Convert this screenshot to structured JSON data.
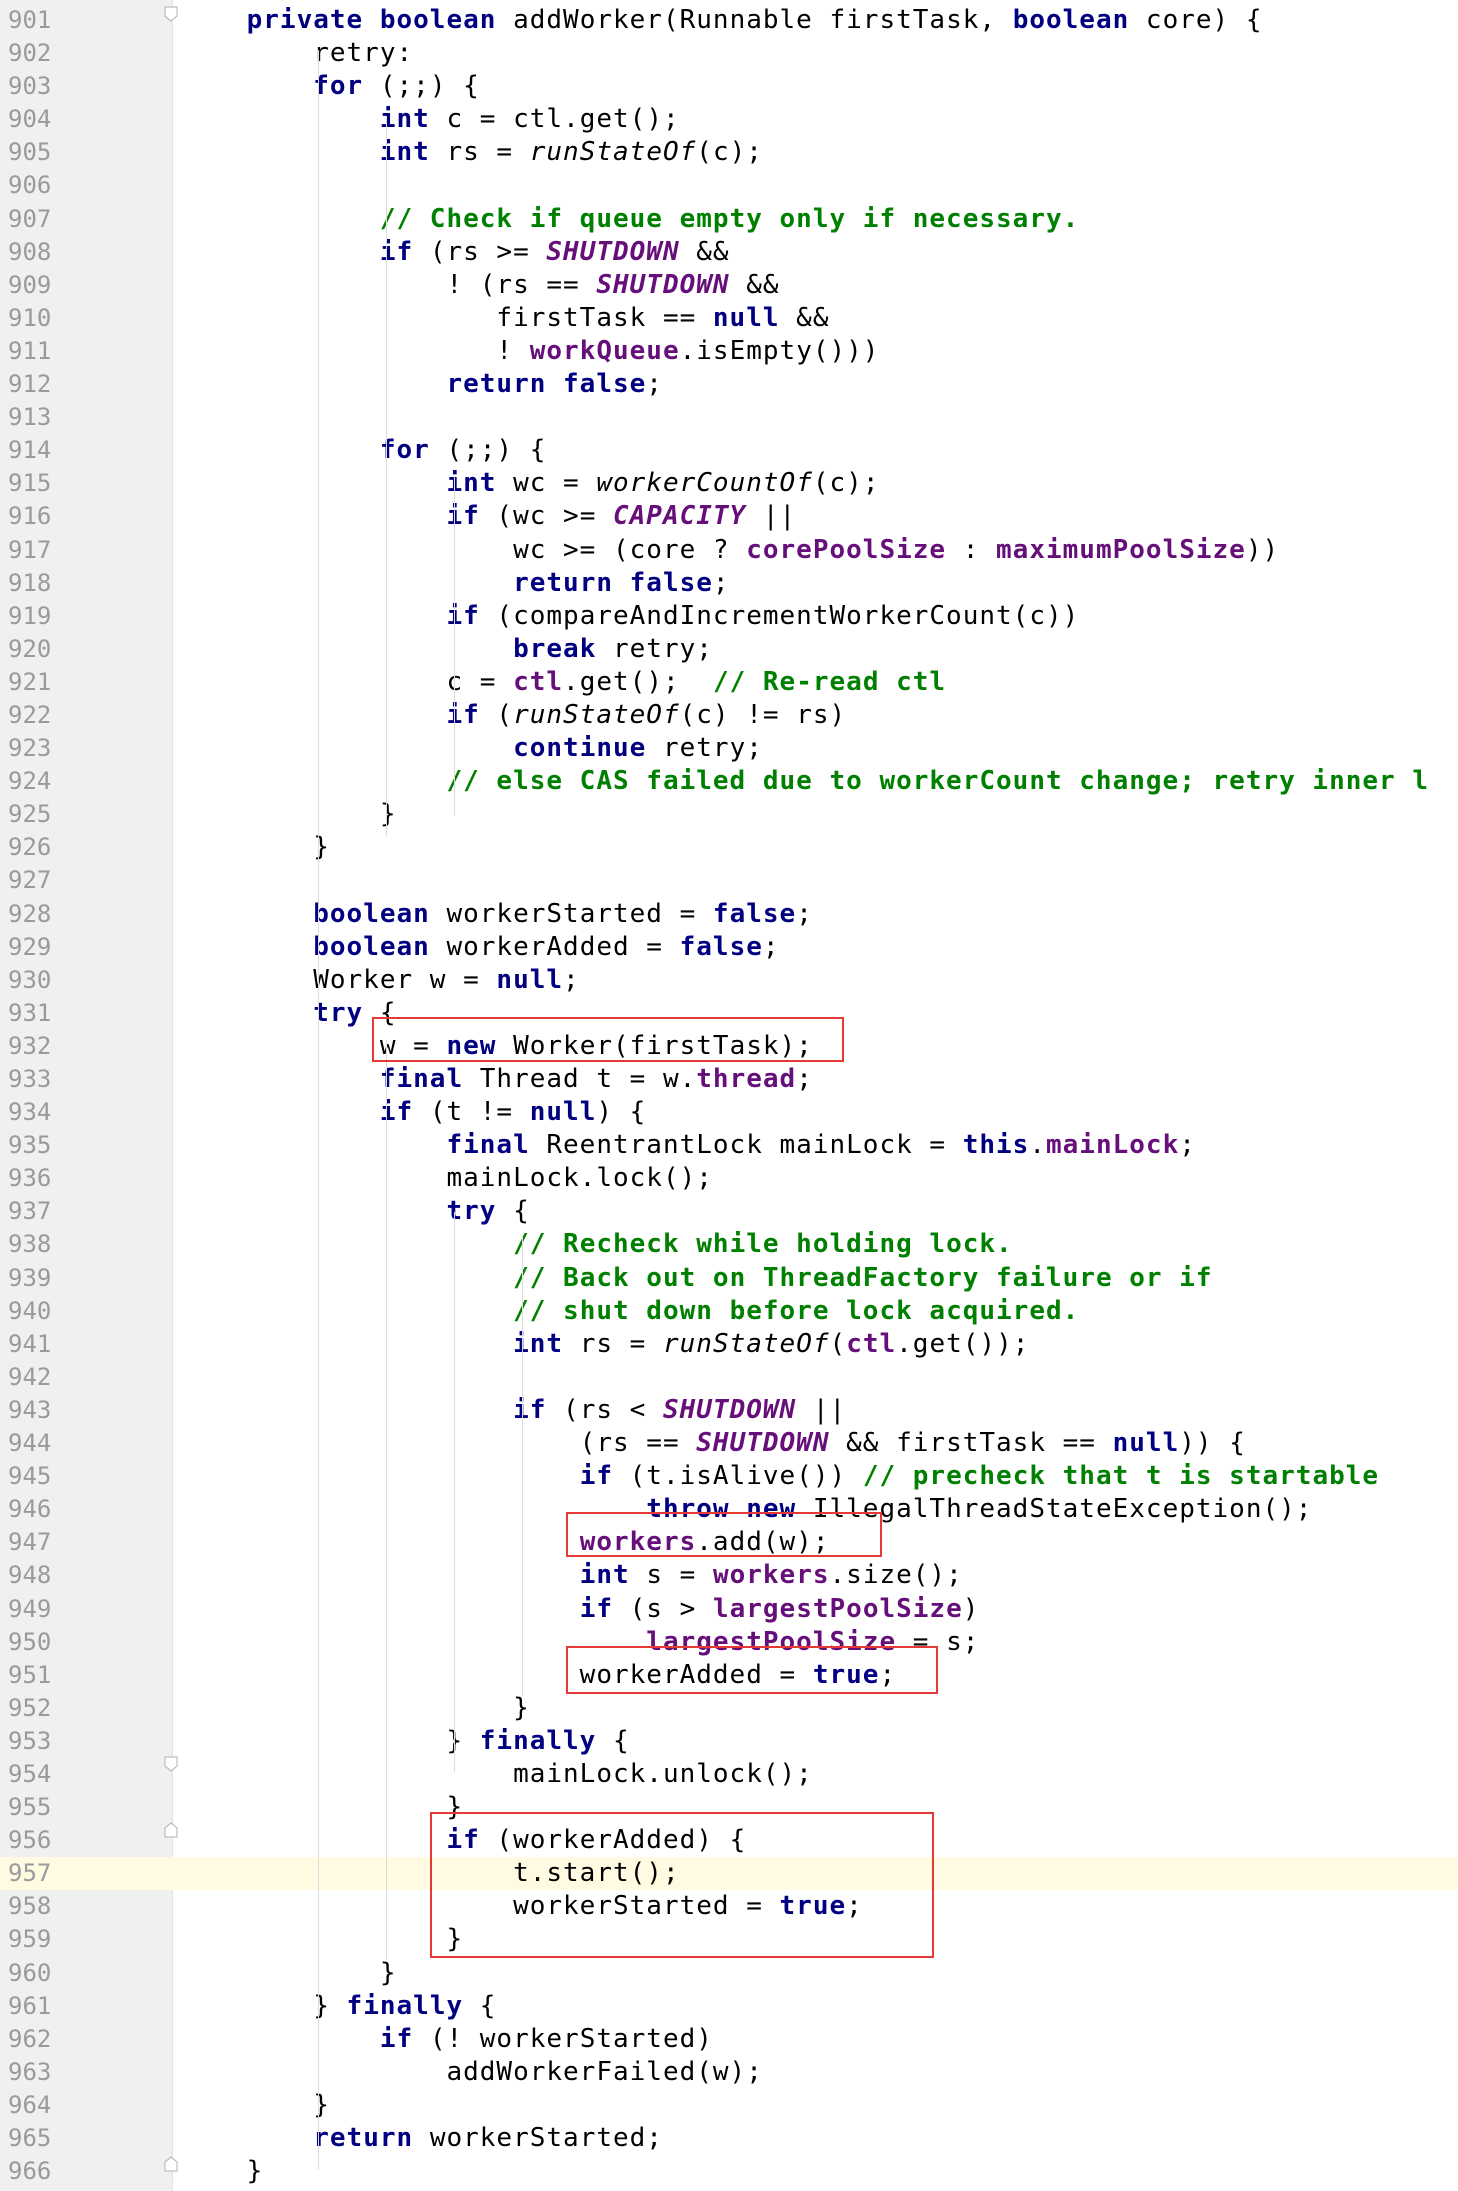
{
  "editor": {
    "colors": {
      "keyword": "#000080",
      "field": "#660e7a",
      "comment": "#008000",
      "highlight_box": "#e53935",
      "caret_line": "#fffbe3",
      "gutter": "#f0f0f0"
    },
    "caret_line": 957,
    "lines": [
      {
        "n": "901",
        "segs": [
          [
            "    ",
            ""
          ],
          [
            "private boolean ",
            "kw"
          ],
          [
            "addWorker(Runnable firstTask, ",
            ""
          ],
          [
            "boolean ",
            "kw"
          ],
          [
            "core) {",
            ""
          ]
        ]
      },
      {
        "n": "902",
        "segs": [
          [
            "        retry:",
            ""
          ]
        ]
      },
      {
        "n": "903",
        "segs": [
          [
            "        ",
            ""
          ],
          [
            "for ",
            "kw"
          ],
          [
            "(;;) {",
            ""
          ]
        ]
      },
      {
        "n": "904",
        "segs": [
          [
            "            ",
            ""
          ],
          [
            "int ",
            "kw"
          ],
          [
            "c = ",
            ""
          ],
          [
            "ctl",
            ""
          ],
          [
            ".get();",
            ""
          ]
        ]
      },
      {
        "n": "905",
        "segs": [
          [
            "            ",
            ""
          ],
          [
            "int ",
            "kw"
          ],
          [
            "rs = ",
            ""
          ],
          [
            "runStateOf",
            "it"
          ],
          [
            "(c);",
            ""
          ]
        ]
      },
      {
        "n": "906",
        "segs": []
      },
      {
        "n": "907",
        "segs": [
          [
            "            ",
            ""
          ],
          [
            "// Check if queue empty only if necessary.",
            "cm"
          ]
        ]
      },
      {
        "n": "908",
        "segs": [
          [
            "            ",
            ""
          ],
          [
            "if ",
            "kw"
          ],
          [
            "(rs >= ",
            ""
          ],
          [
            "SHUTDOWN",
            "cst"
          ],
          [
            " &&",
            ""
          ]
        ]
      },
      {
        "n": "909",
        "segs": [
          [
            "                ! (rs == ",
            ""
          ],
          [
            "SHUTDOWN",
            "cst"
          ],
          [
            " &&",
            ""
          ]
        ]
      },
      {
        "n": "910",
        "segs": [
          [
            "                   firstTask == ",
            ""
          ],
          [
            "null",
            "kw"
          ],
          [
            " &&",
            ""
          ]
        ]
      },
      {
        "n": "911",
        "segs": [
          [
            "                   ! ",
            ""
          ],
          [
            "workQueue",
            "fld"
          ],
          [
            ".isEmpty()))",
            ""
          ]
        ]
      },
      {
        "n": "912",
        "segs": [
          [
            "                ",
            ""
          ],
          [
            "return false",
            "kw"
          ],
          [
            ";",
            ""
          ]
        ]
      },
      {
        "n": "913",
        "segs": []
      },
      {
        "n": "914",
        "segs": [
          [
            "            ",
            ""
          ],
          [
            "for ",
            "kw"
          ],
          [
            "(;;) {",
            ""
          ]
        ]
      },
      {
        "n": "915",
        "segs": [
          [
            "                ",
            ""
          ],
          [
            "int ",
            "kw"
          ],
          [
            "wc = ",
            ""
          ],
          [
            "workerCountOf",
            "it"
          ],
          [
            "(c);",
            ""
          ]
        ]
      },
      {
        "n": "916",
        "segs": [
          [
            "                ",
            ""
          ],
          [
            "if ",
            "kw"
          ],
          [
            "(wc >= ",
            ""
          ],
          [
            "CAPACITY",
            "cst"
          ],
          [
            " ||",
            ""
          ]
        ]
      },
      {
        "n": "917",
        "segs": [
          [
            "                    wc >= (core ? ",
            ""
          ],
          [
            "corePoolSize",
            "fld"
          ],
          [
            " : ",
            ""
          ],
          [
            "maximumPoolSize",
            "fld"
          ],
          [
            "))",
            ""
          ]
        ]
      },
      {
        "n": "918",
        "segs": [
          [
            "                    ",
            ""
          ],
          [
            "return false",
            "kw"
          ],
          [
            ";",
            ""
          ]
        ]
      },
      {
        "n": "919",
        "segs": [
          [
            "                ",
            ""
          ],
          [
            "if ",
            "kw"
          ],
          [
            "(compareAndIncrementWorkerCount(c))",
            ""
          ]
        ]
      },
      {
        "n": "920",
        "segs": [
          [
            "                    ",
            ""
          ],
          [
            "break ",
            "kw"
          ],
          [
            "retry;",
            ""
          ]
        ]
      },
      {
        "n": "921",
        "segs": [
          [
            "                c = ",
            ""
          ],
          [
            "ctl",
            "fld"
          ],
          [
            ".get();  ",
            ""
          ],
          [
            "// Re-read ctl",
            "cm"
          ]
        ]
      },
      {
        "n": "922",
        "segs": [
          [
            "                ",
            ""
          ],
          [
            "if ",
            "kw"
          ],
          [
            "(",
            ""
          ],
          [
            "runStateOf",
            "it"
          ],
          [
            "(c) != rs)",
            ""
          ]
        ]
      },
      {
        "n": "923",
        "segs": [
          [
            "                    ",
            ""
          ],
          [
            "continue ",
            "kw"
          ],
          [
            "retry;",
            ""
          ]
        ]
      },
      {
        "n": "924",
        "segs": [
          [
            "                ",
            ""
          ],
          [
            "// else CAS failed due to workerCount change; retry inner l",
            "cm"
          ]
        ]
      },
      {
        "n": "925",
        "segs": [
          [
            "            }",
            ""
          ]
        ]
      },
      {
        "n": "926",
        "segs": [
          [
            "        }",
            ""
          ]
        ]
      },
      {
        "n": "927",
        "segs": []
      },
      {
        "n": "928",
        "segs": [
          [
            "        ",
            ""
          ],
          [
            "boolean ",
            "kw"
          ],
          [
            "workerStarted = ",
            ""
          ],
          [
            "false",
            "kw"
          ],
          [
            ";",
            ""
          ]
        ]
      },
      {
        "n": "929",
        "segs": [
          [
            "        ",
            ""
          ],
          [
            "boolean ",
            "kw"
          ],
          [
            "workerAdded = ",
            ""
          ],
          [
            "false",
            "kw"
          ],
          [
            ";",
            ""
          ]
        ]
      },
      {
        "n": "930",
        "segs": [
          [
            "        Worker w = ",
            ""
          ],
          [
            "null",
            "kw"
          ],
          [
            ";",
            ""
          ]
        ]
      },
      {
        "n": "931",
        "segs": [
          [
            "        ",
            ""
          ],
          [
            "try ",
            "kw"
          ],
          [
            "{",
            ""
          ]
        ]
      },
      {
        "n": "932",
        "segs": [
          [
            "            w = ",
            ""
          ],
          [
            "new ",
            "kw"
          ],
          [
            "Worker(firstTask);",
            ""
          ]
        ]
      },
      {
        "n": "933",
        "segs": [
          [
            "            ",
            ""
          ],
          [
            "final ",
            "kw"
          ],
          [
            "Thread t = w.",
            ""
          ],
          [
            "thread",
            "fld"
          ],
          [
            ";",
            ""
          ]
        ]
      },
      {
        "n": "934",
        "segs": [
          [
            "            ",
            ""
          ],
          [
            "if ",
            "kw"
          ],
          [
            "(t != ",
            ""
          ],
          [
            "null",
            "kw"
          ],
          [
            ") {",
            ""
          ]
        ]
      },
      {
        "n": "935",
        "segs": [
          [
            "                ",
            ""
          ],
          [
            "final ",
            "kw"
          ],
          [
            "ReentrantLock mainLock = ",
            ""
          ],
          [
            "this",
            "kw"
          ],
          [
            ".",
            ""
          ],
          [
            "mainLock",
            "fld"
          ],
          [
            ";",
            ""
          ]
        ]
      },
      {
        "n": "936",
        "segs": [
          [
            "                mainLock.lock();",
            ""
          ]
        ]
      },
      {
        "n": "937",
        "segs": [
          [
            "                ",
            ""
          ],
          [
            "try ",
            "kw"
          ],
          [
            "{",
            ""
          ]
        ]
      },
      {
        "n": "938",
        "segs": [
          [
            "                    ",
            ""
          ],
          [
            "// Recheck while holding lock.",
            "cm"
          ]
        ]
      },
      {
        "n": "939",
        "segs": [
          [
            "                    ",
            ""
          ],
          [
            "// Back out on ThreadFactory failure or if",
            "cm"
          ]
        ]
      },
      {
        "n": "940",
        "segs": [
          [
            "                    ",
            ""
          ],
          [
            "// shut down before lock acquired.",
            "cm"
          ]
        ]
      },
      {
        "n": "941",
        "segs": [
          [
            "                    ",
            ""
          ],
          [
            "int ",
            "kw"
          ],
          [
            "rs = ",
            ""
          ],
          [
            "runStateOf",
            "it"
          ],
          [
            "(",
            ""
          ],
          [
            "ctl",
            "fld"
          ],
          [
            ".get());",
            ""
          ]
        ]
      },
      {
        "n": "942",
        "segs": []
      },
      {
        "n": "943",
        "segs": [
          [
            "                    ",
            ""
          ],
          [
            "if ",
            "kw"
          ],
          [
            "(rs < ",
            ""
          ],
          [
            "SHUTDOWN",
            "cst"
          ],
          [
            " ||",
            ""
          ]
        ]
      },
      {
        "n": "944",
        "segs": [
          [
            "                        (rs == ",
            ""
          ],
          [
            "SHUTDOWN",
            "cst"
          ],
          [
            " && firstTask == ",
            ""
          ],
          [
            "null",
            "kw"
          ],
          [
            ")) {",
            ""
          ]
        ]
      },
      {
        "n": "945",
        "segs": [
          [
            "                        ",
            ""
          ],
          [
            "if ",
            "kw"
          ],
          [
            "(t.isAlive()) ",
            ""
          ],
          [
            "// precheck that t is startable",
            "cm"
          ]
        ]
      },
      {
        "n": "946",
        "segs": [
          [
            "                            ",
            ""
          ],
          [
            "throw new ",
            "kw"
          ],
          [
            "IllegalThreadStateException();",
            ""
          ]
        ]
      },
      {
        "n": "947",
        "segs": [
          [
            "                        ",
            ""
          ],
          [
            "workers",
            "fld"
          ],
          [
            ".add(w);",
            ""
          ]
        ]
      },
      {
        "n": "948",
        "segs": [
          [
            "                        ",
            ""
          ],
          [
            "int ",
            "kw"
          ],
          [
            "s = ",
            ""
          ],
          [
            "workers",
            "fld"
          ],
          [
            ".size();",
            ""
          ]
        ]
      },
      {
        "n": "949",
        "segs": [
          [
            "                        ",
            ""
          ],
          [
            "if ",
            "kw"
          ],
          [
            "(s > ",
            ""
          ],
          [
            "largestPoolSize",
            "fld"
          ],
          [
            ")",
            ""
          ]
        ]
      },
      {
        "n": "950",
        "segs": [
          [
            "                            ",
            ""
          ],
          [
            "largestPoolSize",
            "fld"
          ],
          [
            " = s;",
            ""
          ]
        ]
      },
      {
        "n": "951",
        "segs": [
          [
            "                        workerAdded = ",
            ""
          ],
          [
            "true",
            "kw"
          ],
          [
            ";",
            ""
          ]
        ]
      },
      {
        "n": "952",
        "segs": [
          [
            "                    }",
            ""
          ]
        ]
      },
      {
        "n": "953",
        "segs": [
          [
            "                } ",
            ""
          ],
          [
            "finally ",
            "kw"
          ],
          [
            "{",
            ""
          ]
        ]
      },
      {
        "n": "954",
        "segs": [
          [
            "                    mainLock.unlock();",
            ""
          ]
        ]
      },
      {
        "n": "955",
        "segs": [
          [
            "                }",
            ""
          ]
        ]
      },
      {
        "n": "956",
        "segs": [
          [
            "                ",
            ""
          ],
          [
            "if ",
            "kw"
          ],
          [
            "(workerAdded) {",
            ""
          ]
        ]
      },
      {
        "n": "957",
        "segs": [
          [
            "                    t.start();",
            ""
          ]
        ]
      },
      {
        "n": "958",
        "segs": [
          [
            "                    workerStarted = ",
            ""
          ],
          [
            "true",
            "kw"
          ],
          [
            ";",
            ""
          ]
        ]
      },
      {
        "n": "959",
        "segs": [
          [
            "                }",
            ""
          ]
        ]
      },
      {
        "n": "960",
        "segs": [
          [
            "            }",
            ""
          ]
        ]
      },
      {
        "n": "961",
        "segs": [
          [
            "        } ",
            ""
          ],
          [
            "finally ",
            "kw"
          ],
          [
            "{",
            ""
          ]
        ]
      },
      {
        "n": "962",
        "segs": [
          [
            "            ",
            ""
          ],
          [
            "if ",
            "kw"
          ],
          [
            "(! workerStarted)",
            ""
          ]
        ]
      },
      {
        "n": "963",
        "segs": [
          [
            "                addWorkerFailed(w);",
            ""
          ]
        ]
      },
      {
        "n": "964",
        "segs": [
          [
            "        }",
            ""
          ]
        ]
      },
      {
        "n": "965",
        "segs": [
          [
            "        ",
            ""
          ],
          [
            "return ",
            "kw"
          ],
          [
            "workerStarted;",
            ""
          ]
        ]
      },
      {
        "n": "966",
        "segs": [
          [
            "    }",
            ""
          ]
        ]
      }
    ]
  }
}
